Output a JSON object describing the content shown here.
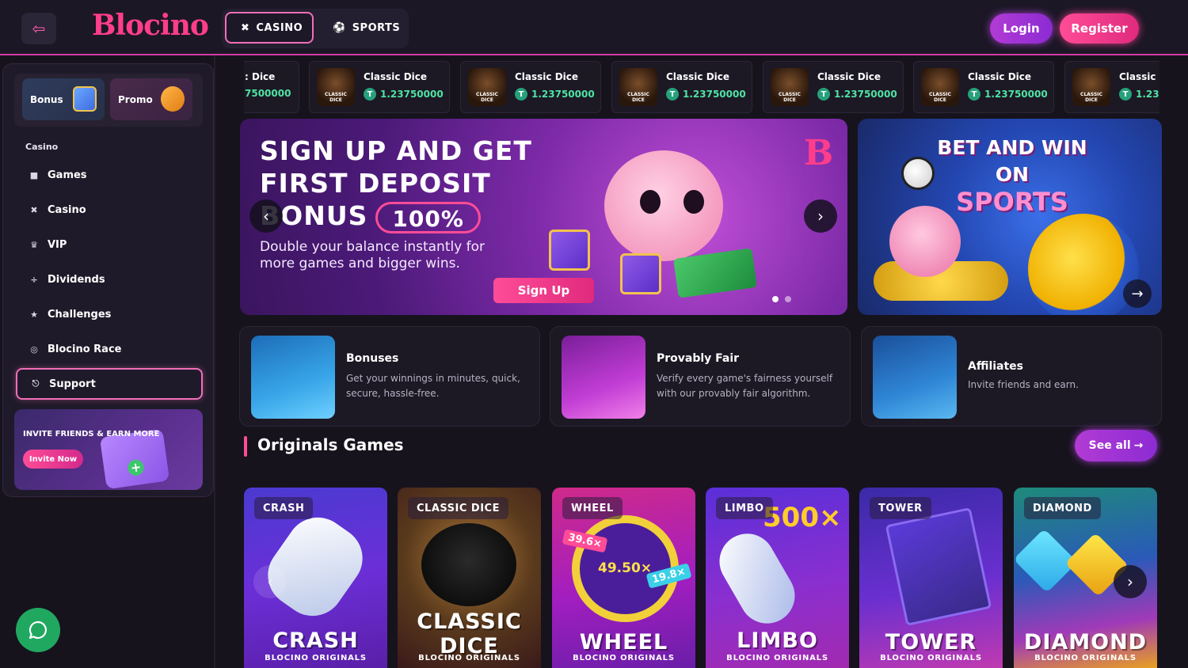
{
  "header": {
    "logo": "Blocino",
    "tabs": [
      {
        "label": "CASINO",
        "icon": "casino-icon",
        "active": true
      },
      {
        "label": "SPORTS",
        "icon": "basketball-icon",
        "active": false
      }
    ],
    "login_label": "Login",
    "register_label": "Register"
  },
  "sidebar": {
    "promo": {
      "bonus_label": "Bonus",
      "promo_label": "Promo"
    },
    "section_label": "Casino",
    "items": [
      {
        "label": "Games",
        "icon": "gamepad-icon"
      },
      {
        "label": "Casino",
        "icon": "casino-icon"
      },
      {
        "label": "VIP",
        "icon": "crown-icon"
      },
      {
        "label": "Dividends",
        "icon": "divide-icon"
      },
      {
        "label": "Challenges",
        "icon": "trophy-icon"
      },
      {
        "label": "Blocino Race",
        "icon": "target-icon"
      },
      {
        "label": "Support",
        "icon": "headset-icon"
      }
    ],
    "invite": {
      "title": "INVITE FRIENDS & EARN MORE",
      "button": "Invite Now"
    }
  },
  "ticker": [
    {
      "name": ": Dice",
      "amount": "7500000",
      "partial_left": true
    },
    {
      "name": "Classic Dice",
      "amount": "1.23750000"
    },
    {
      "name": "Classic Dice",
      "amount": "1.23750000"
    },
    {
      "name": "Classic Dice",
      "amount": "1.23750000"
    },
    {
      "name": "Classic Dice",
      "amount": "1.23750000"
    },
    {
      "name": "Classic Dice",
      "amount": "1.23750000"
    },
    {
      "name": "Classic I",
      "amount": "1.23"
    }
  ],
  "banner_main": {
    "title_line1": "SIGN UP AND GET",
    "title_line2": "FIRST DEPOSIT",
    "title_line3": "BONUS",
    "badge": "100%",
    "subtitle": "Double your balance instantly for more games and bigger wins.",
    "cta": "Sign Up",
    "brand_mark": "B"
  },
  "banner_sports": {
    "line1": "BET AND WIN ON",
    "line2": "SPORTS"
  },
  "features": [
    {
      "title": "Bonuses",
      "desc": "Get your winnings in minutes, quick, secure, hassle-free."
    },
    {
      "title": "Provably Fair",
      "desc": "Verify every game's fairness yourself with our provably fair algorithm."
    },
    {
      "title": "Affiliates",
      "desc": "Invite friends and earn."
    }
  ],
  "originals": {
    "title": "Originals Games",
    "see_all": "See all",
    "games": [
      {
        "tag": "CRASH",
        "name": "CRASH",
        "sub": "BLOCINO ORIGINALS"
      },
      {
        "tag": "CLASSIC DICE",
        "name_line1": "CLASSIC",
        "name_line2": "DICE",
        "sub": "BLOCINO ORIGINALS"
      },
      {
        "tag": "WHEEL",
        "name": "WHEEL",
        "sub": "BLOCINO ORIGINALS",
        "m1": "39.6×",
        "m2": "49.50×",
        "m3": "19.8×"
      },
      {
        "tag": "LIMBO",
        "name": "LIMBO",
        "sub": "BLOCINO ORIGINALS",
        "mult": "500×"
      },
      {
        "tag": "TOWER",
        "name": "TOWER",
        "sub": "BLOCINO ORIGINALS"
      },
      {
        "tag": "DIAMOND",
        "name": "DIAMOND",
        "sub": "BLOCINO ORIGINALS"
      }
    ]
  },
  "colors": {
    "accent": "#ff4c97",
    "purple": "#a63ccf",
    "bg": "#16131d",
    "ticker_green": "#4fe3a3"
  }
}
